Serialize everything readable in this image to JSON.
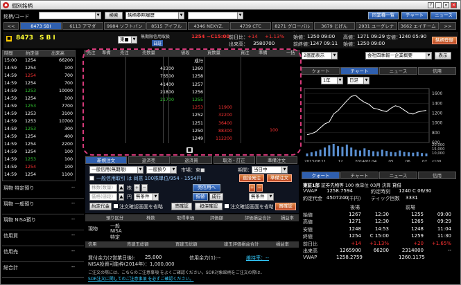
{
  "window": {
    "title": "個別銘柄",
    "controls": [
      "?",
      "■",
      "?",
      "_",
      "▫",
      "×"
    ]
  },
  "toolbar": {
    "code_label": "銘柄/コード",
    "search_button": "検索",
    "history_select": "銘柄参照履歴",
    "compare_button": "同業種一覧",
    "chart_button": "チャート",
    "news_button": "ニュース"
  },
  "ticker_tabs": {
    "prev": "<<",
    "items": [
      "8473 SBI",
      "6113 アマダ",
      "9984 ソフトバンク",
      "8515 アイフル",
      "4346 NEXYZ.",
      "4739 CTC",
      "8271 グローバルダ",
      "3679 じげん",
      "2931 ユーグレナ",
      "3662 エイチーム"
    ],
    "next": ">>"
  },
  "stock_header": {
    "code": "8473",
    "name": "SBI",
    "market": "東■",
    "credit_label": "無期限信用取扱",
    "sub_badge": "日証",
    "price": "1254",
    "change": "−C15:00",
    "prev_close_label": "前日比：",
    "prev_close_value": "+14",
    "prev_close_pct": "+1.13%",
    "open_label": "始値：",
    "open_value": "1250 09:00",
    "high_label": "高値：",
    "high_value": "1271 09:29",
    "low_label": "安値：",
    "low_value": "1240 05:90",
    "volume_label": "出来高：",
    "volume_value": "3580700",
    "vwap_label": "前終値：",
    "vwap_value": "1247 09:11",
    "prev_label": "始値：",
    "prev_value": "1250 09:00",
    "register_button": "銘柄登録"
  },
  "tick_table": {
    "headers": [
      "時間",
      "約定値",
      "出来高"
    ],
    "rows": [
      {
        "t": "15:00",
        "p": "1254",
        "v": "66200",
        "pc": "w"
      },
      {
        "t": "14:59",
        "p": "1254",
        "v": "100",
        "pc": "w"
      },
      {
        "t": "14:59",
        "p": "1254",
        "v": "700",
        "pc": "r"
      },
      {
        "t": "14:59",
        "p": "1254",
        "v": "700",
        "pc": "w"
      },
      {
        "t": "14:59",
        "p": "1253",
        "v": "10000",
        "pc": "g"
      },
      {
        "t": "14:59",
        "p": "1254",
        "v": "100",
        "pc": "w"
      },
      {
        "t": "14:59",
        "p": "1253",
        "v": "7700",
        "pc": "g"
      },
      {
        "t": "14:59",
        "p": "1253",
        "v": "3100",
        "pc": "w"
      },
      {
        "t": "14:59",
        "p": "1253",
        "v": "10700",
        "pc": "w"
      },
      {
        "t": "14:59",
        "p": "1253",
        "v": "300",
        "pc": "g"
      },
      {
        "t": "14:59",
        "p": "1254",
        "v": "400",
        "pc": "w"
      },
      {
        "t": "14:59",
        "p": "1254",
        "v": "2200",
        "pc": "w"
      },
      {
        "t": "14:59",
        "p": "1254",
        "v": "100",
        "pc": "w"
      },
      {
        "t": "14:59",
        "p": "1253",
        "v": "100",
        "pc": "g"
      },
      {
        "t": "14:59",
        "p": "1254",
        "v": "100",
        "pc": "r"
      },
      {
        "t": "14:59",
        "p": "1254",
        "v": "1100",
        "pc": "w"
      }
    ]
  },
  "order_book": {
    "headers": [
      "売注",
      "準備",
      "売注",
      "売数量",
      "値段",
      "買数量",
      "買注",
      "準備",
      "一括"
    ],
    "rows": [
      {
        "sell": "",
        "price": "成行",
        "buy": "",
        "sc": "w",
        "pcol": "w"
      },
      {
        "sell": "42300",
        "price": "1260",
        "buy": "",
        "sc": "w",
        "pcol": "w"
      },
      {
        "sell": "76500",
        "price": "1258",
        "buy": "",
        "sc": "w",
        "pcol": "w"
      },
      {
        "sell": "41400",
        "price": "1257",
        "buy": "",
        "sc": "w",
        "pcol": "w"
      },
      {
        "sell": "21800",
        "price": "1256",
        "buy": "",
        "sc": "w",
        "pcol": "w"
      },
      {
        "sell": "21700",
        "price": "1255",
        "buy": "",
        "sc": "g",
        "pcol": "g"
      },
      {
        "sell": "",
        "price": "1253",
        "buy": "11900",
        "sc": "w",
        "pcol": "r"
      },
      {
        "sell": "",
        "price": "1252",
        "buy": "32200",
        "sc": "w",
        "pcol": "w"
      },
      {
        "sell": "",
        "price": "1251",
        "buy": "36400",
        "sc": "w",
        "pcol": "w"
      },
      {
        "sell": "",
        "price": "1250",
        "buy": "88300",
        "sc": "w",
        "pcol": "w"
      },
      {
        "sell": "",
        "price": "1249",
        "buy": "112200",
        "sc": "w",
        "pcol": "w"
      }
    ],
    "red_marker": "100",
    "trash_icon": "trash-icon"
  },
  "order_tabs": [
    "新規注文",
    "返済売",
    "返済買",
    "取消・訂正",
    "準備注文"
  ],
  "order_form": {
    "type_select": "一般信用(無期限)",
    "side_select": "一般預り",
    "market_label": "市場：東■",
    "period_label": "期間：",
    "period_select": "当日中",
    "check_text": "一般信用取引 は 同意 100株単位/954 - 1554円",
    "direct_button": "直接発注",
    "prepare_button": "準備注文",
    "qty_placeholder": "株数(数量)",
    "unit_label": "株",
    "price_placeholder": "価格(値段)",
    "yen_label": "円",
    "sell_button": "売信用へ",
    "plus": "+",
    "minus": "−",
    "no_cond": "無条件",
    "limit_button": "指値",
    "market_button": "成行",
    "no_cond2": "無条件",
    "confirm_label": "注文確認画面を省略",
    "margin_check_button": "担保確認",
    "cross_button": "約定代金",
    "confirm_label2": "注文確認画面を省略",
    "buy_confirm_button": "買確認",
    "sell_confirm_button": "売確認"
  },
  "position_left": {
    "items": [
      {
        "label": "現物 特定預り",
        "value": "--"
      },
      {
        "label": "現物 一般預り",
        "value": "--"
      },
      {
        "label": "現物 NISA預り",
        "value": "--"
      },
      {
        "label": "信用買",
        "value": "--"
      },
      {
        "label": "信用売",
        "value": "--"
      },
      {
        "label": "総合計",
        "value": "--"
      }
    ]
  },
  "position_table": {
    "headers": [
      "預り区分",
      "株数",
      "取得単価",
      "評価額",
      "評価損益合計",
      "損益率"
    ],
    "rows": [
      {
        "label": "現物",
        "sub": [
          "一般",
          "NISA",
          "特定"
        ]
      },
      {
        "label": "信用",
        "sub": [
          "売建玉総額",
          "買建玉総額",
          "建玉評価損益合計",
          "損益率"
        ]
      }
    ],
    "footer_left": "買付余力(2営業日後):",
    "footer_value": "25,000",
    "footer_margin_label": "信用余力(1):--",
    "footer_margin_link": "維持率：--",
    "footer_nisa": "NISA投資可能枠(2014年)：1,000,000",
    "notice1": "ご注文の際には、こちらのご注意事項 をよくご確認ください。SOR対象銘柄をご注文の際は、",
    "notice2": "SOR注文に関してのご注意事項 を必ずご確認ください。"
  },
  "right_panel": {
    "display_select": "2画面表示",
    "company_select": "会社四季報－企業概要",
    "show_button": "表示",
    "tabs": [
      "クォート",
      "チャート",
      "ニュース",
      "信用"
    ],
    "period_select": "1年",
    "interval_select": "日足",
    "y_ticks": [
      "1600",
      "1400",
      "1200",
      "1000",
      "800",
      "600"
    ],
    "x_ticks": [
      "2013/08",
      "11",
      "12",
      "2014/01",
      "04",
      "05",
      "06",
      "07"
    ],
    "vol_ticks": [
      "20,000",
      "15,000",
      "10,000"
    ],
    "vol_unit": "x100",
    "chart_data": {
      "type": "line",
      "series": [
        {
          "values": [
            760,
            780,
            820,
            900,
            980,
            1020,
            1180,
            1250,
            1350,
            1450,
            1540,
            1560,
            1480,
            1420,
            1380,
            1300,
            1280,
            1250,
            1230,
            1300,
            1350,
            1320,
            1260,
            1200,
            1180,
            1220,
            1240,
            1254
          ]
        }
      ],
      "ylim": [
        600,
        1700
      ],
      "volumes": [
        40,
        55,
        70,
        90,
        120,
        150,
        170,
        140,
        130,
        160,
        120,
        90,
        80,
        110,
        85,
        70,
        65,
        90,
        75,
        60,
        55,
        80,
        60,
        55,
        50,
        60,
        45,
        40
      ]
    },
    "quote_tabs": [
      "クォート",
      "チャート",
      "ニュース",
      "信用"
    ],
    "company_line": {
      "market": "東証1部",
      "sector": "証券先物等",
      "unit": "100",
      "unit_label": "株単位",
      "fy": "03月",
      "fy_label": "決算",
      "cred": "貸借"
    },
    "vwap_row": {
      "label": "VWAP",
      "value": "1258.7594",
      "time_label": "約定時刻",
      "time_value": "1240 C 06/30"
    },
    "cap_row": {
      "label": "約定代金",
      "value": "4507240",
      "unit": "(千円)",
      "tick_label": "ティック回数",
      "tick_value": "3331"
    },
    "quote_headers": [
      "",
      "後場",
      "",
      "前場",
      ""
    ],
    "quote_rows": [
      {
        "label": "始値",
        "a": "1267",
        "b": "12:30",
        "c": "1255",
        "d": "09:00"
      },
      {
        "label": "高値",
        "a": "1271",
        "b": "12:30",
        "c": "1265",
        "d": "09:29"
      },
      {
        "label": "安値",
        "a": "1248",
        "b": "14:53",
        "c": "1248",
        "d": "11:04"
      },
      {
        "label": "終値",
        "a": "1254",
        "b": "C 15:00",
        "c": "1259",
        "d": "11:30"
      },
      {
        "label": "前日比",
        "a": "+14",
        "b": "+1.13%",
        "c": "+20",
        "d": "+1.65%"
      },
      {
        "label": "出来高",
        "a": "1265900",
        "b": "66200",
        "c": "2314800",
        "d": "--"
      },
      {
        "label": "VWAP",
        "a": "1258.2759",
        "b": "",
        "c": "1260.1175",
        "d": ""
      }
    ]
  },
  "colors": {
    "accent_blue": "#2f5fae",
    "magenta_outline": "#d63a7a",
    "up_red": "#ff3333",
    "down_green": "#33cc33"
  }
}
